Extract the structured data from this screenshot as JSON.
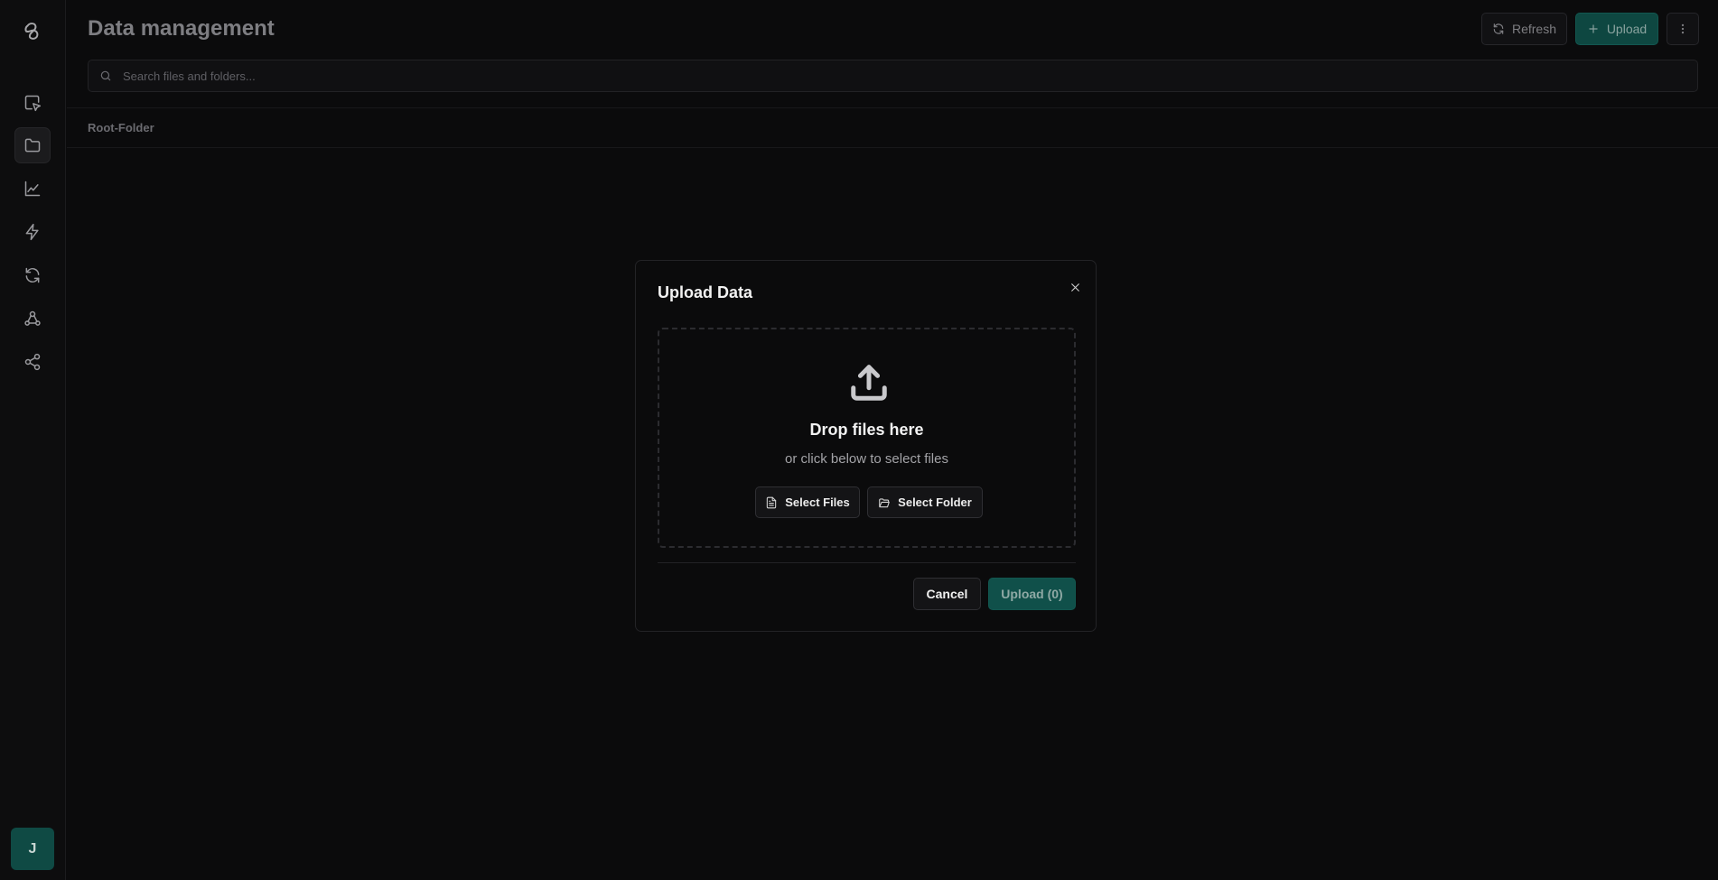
{
  "sidebar": {
    "logo": "app-logo",
    "items": [
      {
        "id": "editor",
        "icon": "pointer-square-icon",
        "active": false
      },
      {
        "id": "data",
        "icon": "folder-icon",
        "active": true
      },
      {
        "id": "analytics",
        "icon": "line-chart-icon",
        "active": false
      },
      {
        "id": "actions",
        "icon": "lightning-icon",
        "active": false
      },
      {
        "id": "sync",
        "icon": "refresh-icon",
        "active": false
      },
      {
        "id": "webhooks",
        "icon": "webhook-icon",
        "active": false
      },
      {
        "id": "share",
        "icon": "share-icon",
        "active": false
      }
    ],
    "avatar_initial": "J"
  },
  "header": {
    "title": "Data management",
    "refresh_label": "Refresh",
    "upload_label": "Upload",
    "more_icon": "more-vertical-icon"
  },
  "search": {
    "placeholder": "Search files and folders..."
  },
  "breadcrumb": {
    "root": "Root-Folder"
  },
  "modal": {
    "title": "Upload Data",
    "drop_title": "Drop files here",
    "drop_subtitle": "or click below to select files",
    "select_files_label": "Select Files",
    "select_folder_label": "Select Folder",
    "cancel_label": "Cancel",
    "upload_label": "Upload (0)"
  },
  "colors": {
    "background": "#0b0b0c",
    "accent": "#0e4741",
    "border": "#232326"
  }
}
